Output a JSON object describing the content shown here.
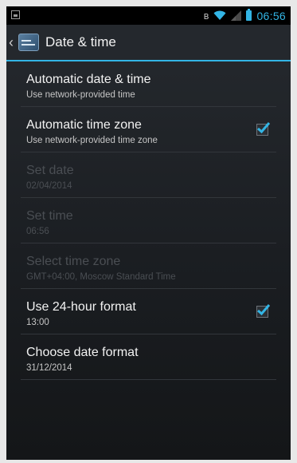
{
  "status_bar": {
    "time": "06:56",
    "icons": [
      "notification-icon",
      "bluetooth-icon",
      "wifi-icon",
      "signal-icon",
      "battery-icon"
    ]
  },
  "action_bar": {
    "title": "Date & time",
    "back_icon": "chevron-left-icon",
    "app_icon": "settings-icon"
  },
  "settings": [
    {
      "title": "Automatic date & time",
      "summary": "Use network-provided time",
      "enabled": true,
      "checkbox": false
    },
    {
      "title": "Automatic time zone",
      "summary": "Use network-provided time zone",
      "enabled": true,
      "checkbox": true,
      "checked": true
    },
    {
      "title": "Set date",
      "summary": "02/04/2014",
      "enabled": false,
      "checkbox": false
    },
    {
      "title": "Set time",
      "summary": "06:56",
      "enabled": false,
      "checkbox": false
    },
    {
      "title": "Select time zone",
      "summary": "GMT+04:00, Moscow Standard Time",
      "enabled": false,
      "checkbox": false
    },
    {
      "title": "Use 24-hour format",
      "summary": "13:00",
      "enabled": true,
      "checkbox": true,
      "checked": true
    },
    {
      "title": "Choose date format",
      "summary": "31/12/2014",
      "enabled": true,
      "checkbox": false
    }
  ],
  "colors": {
    "accent": "#33b5e5",
    "disabled_text": "#4a4e53"
  }
}
